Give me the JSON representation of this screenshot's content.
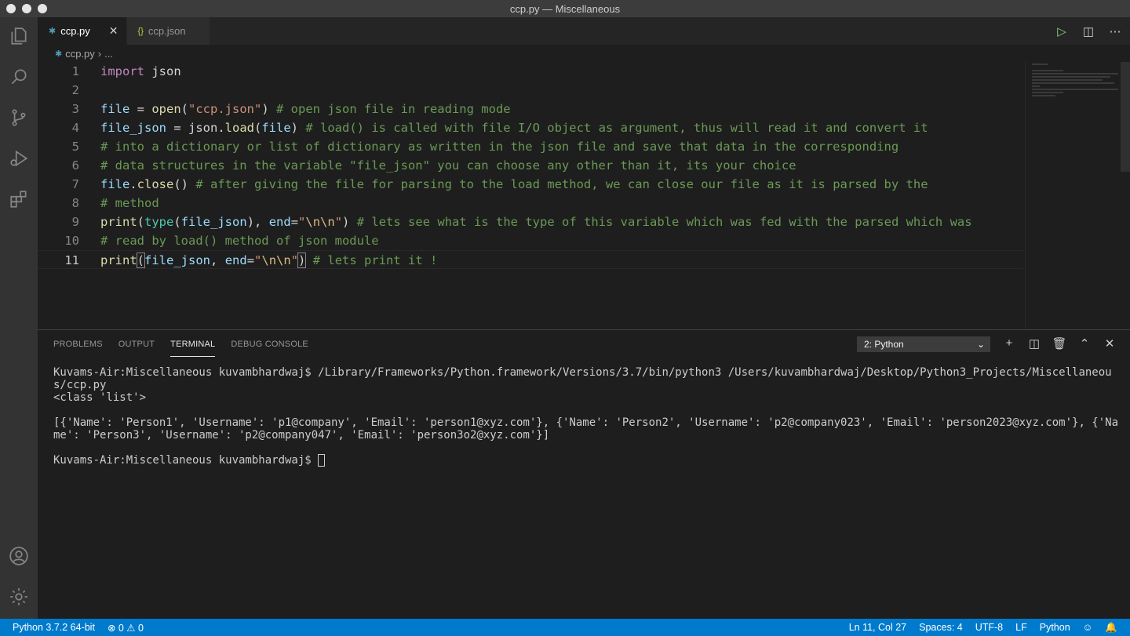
{
  "window": {
    "title": "ccp.py — Miscellaneous"
  },
  "tabs": [
    {
      "label": "ccp.py",
      "icon": "python-file-icon",
      "close": "✕"
    },
    {
      "label": "ccp.json",
      "icon": "json-file-icon"
    }
  ],
  "breadcrumb": {
    "file": "ccp.py",
    "sep": "›",
    "more": "..."
  },
  "code": {
    "line_numbers": [
      "1",
      "2",
      "3",
      "4",
      "5",
      "6",
      "7",
      "8",
      "9",
      "10",
      "11"
    ],
    "current_line": 11
  },
  "panel": {
    "tabs": [
      "PROBLEMS",
      "OUTPUT",
      "TERMINAL",
      "DEBUG CONSOLE"
    ],
    "active_tab": "TERMINAL",
    "terminal_select": "2: Python",
    "terminal": [
      "Kuvams-Air:Miscellaneous kuvambhardwaj$ /Library/Frameworks/Python.framework/Versions/3.7/bin/python3 /Users/kuvambhardwaj/Desktop/Python3_Projects/Miscellaneous/ccp.py",
      "<class 'list'>",
      "",
      "[{'Name': 'Person1', 'Username': 'p1@company', 'Email': 'person1@xyz.com'}, {'Name': 'Person2', 'Username': 'p2@company023', 'Email': 'person2023@xyz.com'}, {'Name': 'Person3', 'Username': 'p2@company047', 'Email': 'person3o2@xyz.com'}]",
      "",
      "Kuvams-Air:Miscellaneous kuvambhardwaj$ "
    ]
  },
  "statusbar": {
    "interpreter": "Python 3.7.2 64-bit",
    "problems": "⊗ 0 ⚠ 0",
    "position": "Ln 11, Col 27",
    "spaces": "Spaces: 4",
    "encoding": "UTF-8",
    "eol": "LF",
    "language": "Python"
  },
  "colors": {
    "statusbar": "#007acc",
    "editor_bg": "#1e1e1e",
    "comment": "#6a9955",
    "keyword": "#c586c0",
    "string": "#ce9178",
    "function": "#dcdcaa"
  }
}
